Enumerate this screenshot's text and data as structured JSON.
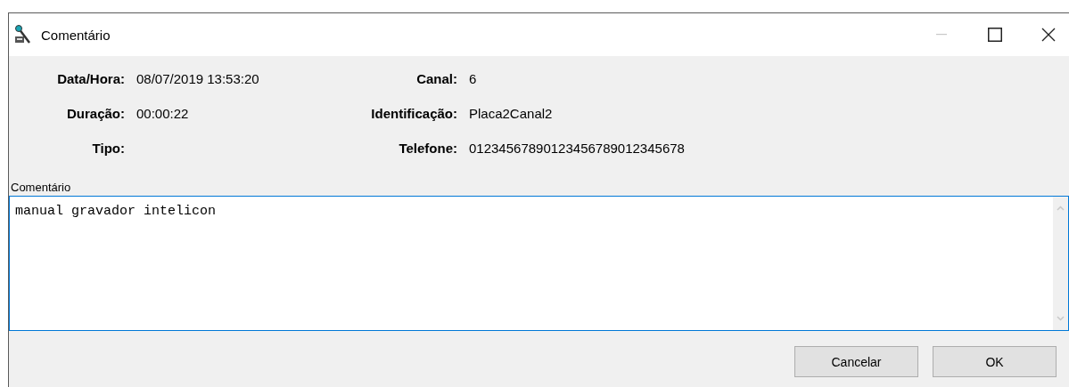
{
  "window": {
    "title": "Comentário",
    "controls": [
      {
        "kind": "minimize",
        "disabled": true
      },
      {
        "kind": "maximize",
        "disabled": false
      },
      {
        "kind": "close",
        "disabled": false
      }
    ]
  },
  "fields": [
    {
      "label": "Data/Hora:",
      "value": "08/07/2019 13:53:20"
    },
    {
      "label": "Canal:",
      "value": "6"
    },
    {
      "label": "Duração:",
      "value": "00:00:22"
    },
    {
      "label": "Identificação:",
      "value": "Placa2Canal2"
    },
    {
      "label": "Tipo:"
    },
    {
      "label": "Telefone:",
      "value": "01234567890123456789012345678"
    }
  ],
  "comment": {
    "label": "Comentário",
    "value": "manual gravador intelicon"
  },
  "buttons": [
    "Cancelar",
    "OK"
  ]
}
